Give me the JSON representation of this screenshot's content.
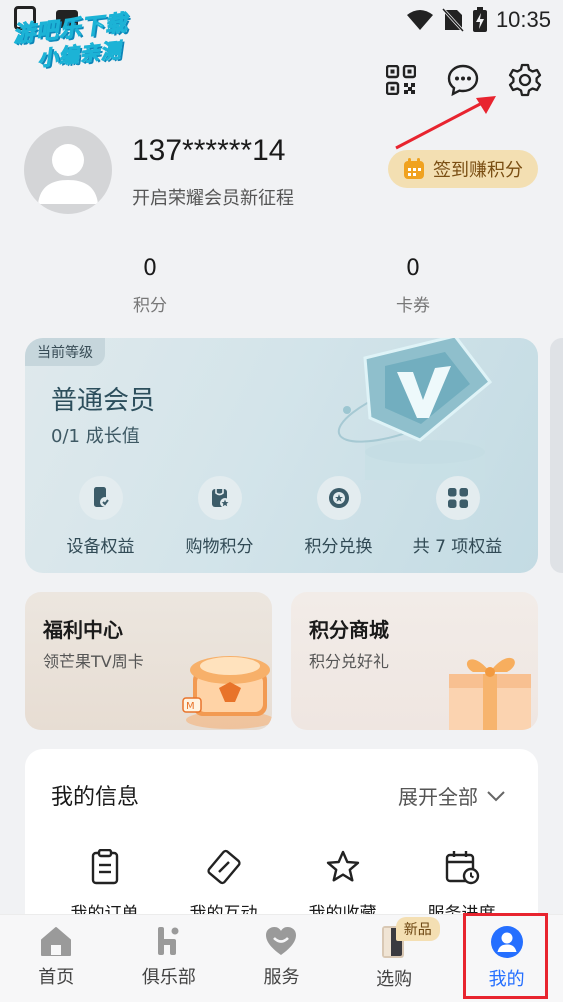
{
  "status_bar": {
    "time": "10:35"
  },
  "watermark": {
    "line1": "游吧乐下载",
    "line2": "小编亲测"
  },
  "profile": {
    "username": "137******14",
    "subtitle": "开启荣耀会员新征程",
    "signin_label": "签到赚积分"
  },
  "stats": [
    {
      "value": "0",
      "label": "积分"
    },
    {
      "value": "0",
      "label": "卡券"
    }
  ],
  "membership": {
    "tag": "当前等级",
    "level": "普通会员",
    "growth": "0/1 成长值",
    "perks": [
      {
        "label": "设备权益",
        "icon": "device-benefit-icon"
      },
      {
        "label": "购物积分",
        "icon": "shopping-points-icon"
      },
      {
        "label": "积分兑换",
        "icon": "points-exchange-icon"
      },
      {
        "label": "共 7 项权益",
        "icon": "grid-icon"
      }
    ]
  },
  "cards": {
    "welfare": {
      "title": "福利中心",
      "subtitle": "领芒果TV周卡"
    },
    "mall": {
      "title": "积分商城",
      "subtitle": "积分兑好礼"
    }
  },
  "info": {
    "title": "我的信息",
    "expand_label": "展开全部",
    "items": [
      {
        "label": "我的订单",
        "icon": "order-icon"
      },
      {
        "label": "我的互动",
        "icon": "interaction-icon"
      },
      {
        "label": "我的收藏",
        "icon": "star-icon"
      },
      {
        "label": "服务进度",
        "icon": "service-progress-icon"
      }
    ]
  },
  "bottom_nav": {
    "items": [
      {
        "label": "首页",
        "icon": "home-icon"
      },
      {
        "label": "俱乐部",
        "icon": "club-icon"
      },
      {
        "label": "服务",
        "icon": "heart-icon"
      },
      {
        "label": "选购",
        "icon": "phone-icon",
        "badge": "新品"
      },
      {
        "label": "我的",
        "icon": "person-icon",
        "active": true
      }
    ]
  },
  "colors": {
    "accent": "#256fff",
    "highlight_box": "#e8242f",
    "signin_bg": "#f3dfb2"
  }
}
